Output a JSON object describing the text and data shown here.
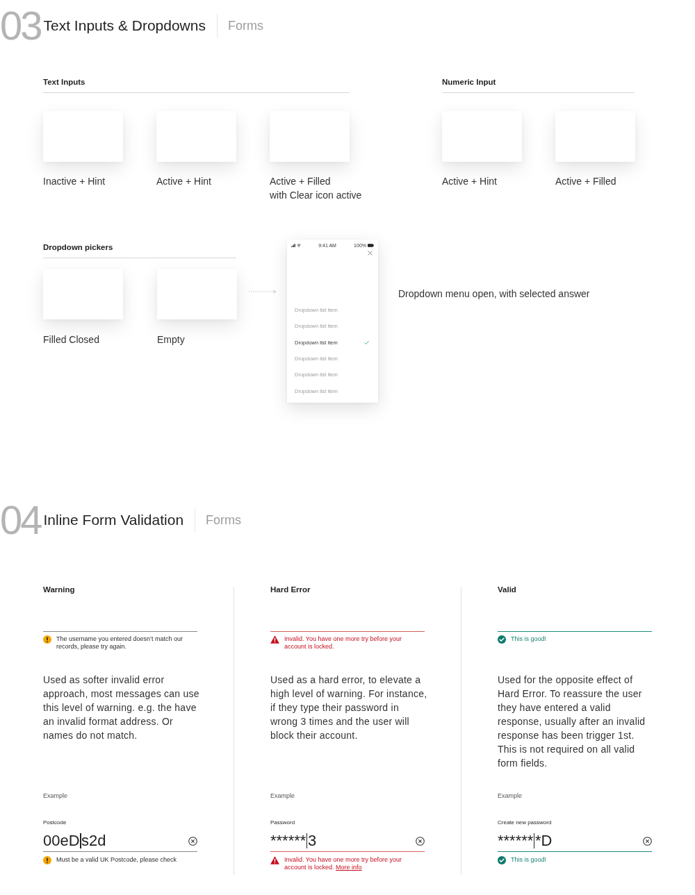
{
  "header_03": {
    "number": "03",
    "title": "Text Inputs & Dropdowns",
    "category": "Forms"
  },
  "text_inputs": {
    "heading": "Text Inputs",
    "items": [
      {
        "label": "Inactive + Hint"
      },
      {
        "label": "Active + Hint"
      },
      {
        "label": "Active + Filled",
        "note": "with Clear icon active"
      }
    ]
  },
  "numeric_input": {
    "heading": "Numeric Input",
    "items": [
      {
        "label": "Active + Hint"
      },
      {
        "label": "Active + Filled"
      }
    ]
  },
  "dropdown_pickers": {
    "heading": "Dropdown pickers",
    "items": [
      {
        "label": "Filled Closed"
      },
      {
        "label": "Empty"
      }
    ]
  },
  "dropdown_preview": {
    "status_bar": {
      "time": "9:41 AM",
      "battery": "100%"
    },
    "items": [
      {
        "label": "Dropdown list item",
        "selected": false
      },
      {
        "label": "Dropdown list item",
        "selected": false
      },
      {
        "label": "Dropdown list item",
        "selected": true
      },
      {
        "label": "Dropdown list item",
        "selected": false
      },
      {
        "label": "Dropdown list item",
        "selected": false
      },
      {
        "label": "Dropdown list item",
        "selected": false
      }
    ],
    "caption": "Dropdown menu open, with selected answer"
  },
  "header_04": {
    "number": "04",
    "title": "Inline Form Validation",
    "category": "Forms"
  },
  "validation": [
    {
      "kind": "warning",
      "heading": "Warning",
      "message": "The username you entered doesn’t match our records, please try again.",
      "description": "Used as softer invalid error approach, most messages can use this level of warning. e.g. the have an invalid format address. Or names do not match.",
      "example_label": "Example",
      "field": {
        "label": "Postcode",
        "value_before_cursor": "00eD",
        "value_after_cursor": "s2d",
        "message": "Must be a valid UK Postcode, please check"
      }
    },
    {
      "kind": "error",
      "heading": "Hard Error",
      "message": "Invalid. You have one more try before your account is locked.",
      "description": "Used as a hard error, to elevate a high level of warning. For instance, if they type their password in wrong 3 times and the user will block their account.",
      "example_label": "Example",
      "field": {
        "label": "Password",
        "value_before_cursor": "******",
        "value_after_cursor": "3",
        "message": "Invalid. You have one more try before your account is locked.",
        "link": "More info"
      }
    },
    {
      "kind": "valid",
      "heading": "Valid",
      "message": "This is good!",
      "description": "Used for the opposite effect of Hard Error. To reassure the user they have entered a valid response, usually after an invalid response has been trigger 1st. This is not required on all valid form fields.",
      "example_label": "Example",
      "field": {
        "label": "Create new password",
        "value_before_cursor": "******",
        "value_after_cursor": "*D",
        "message": "This is good!"
      }
    }
  ]
}
